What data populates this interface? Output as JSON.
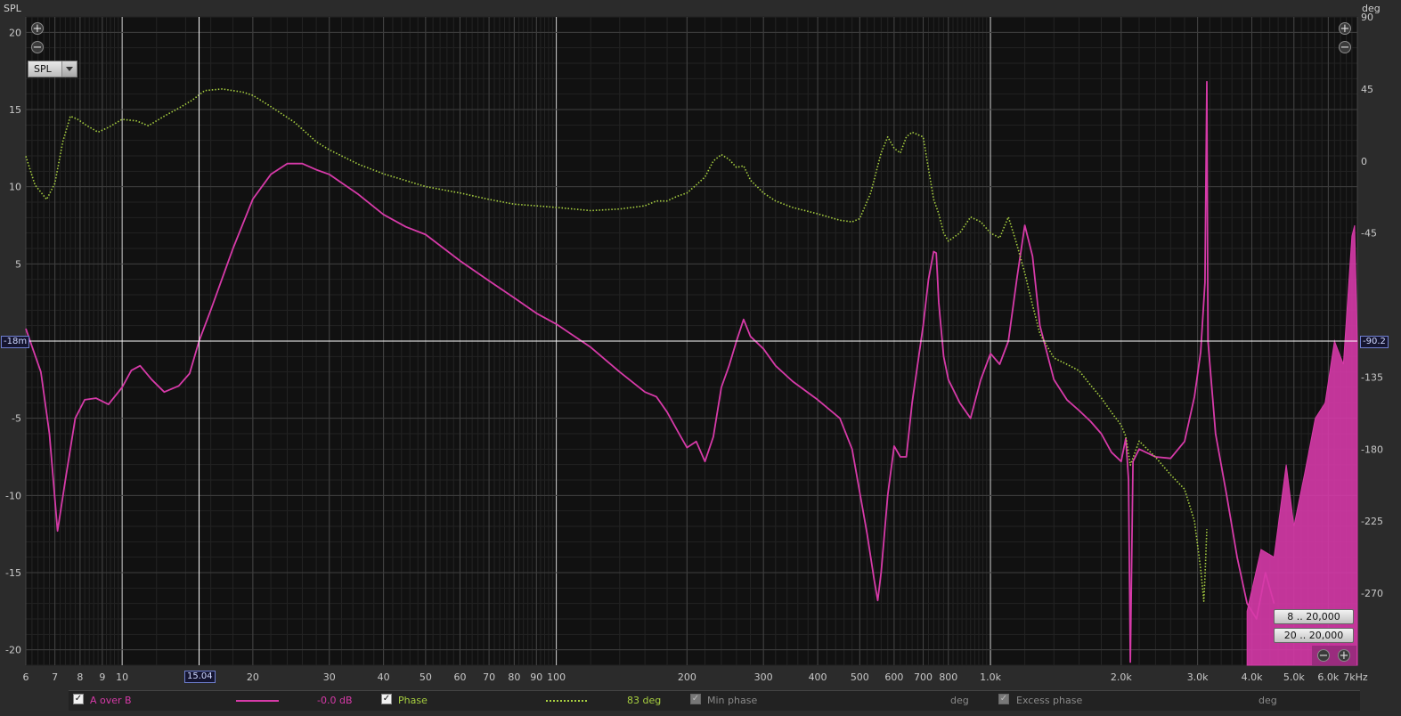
{
  "chart_data": {
    "type": "line",
    "x_scale": "log",
    "xlim": [
      6,
      7000
    ],
    "ylim_left": [
      -21,
      21
    ],
    "ylim_right": [
      -315,
      90
    ],
    "y_left_unit": "SPL",
    "y_right_unit": "deg",
    "x_unit": "kHz",
    "x_ticks": [
      {
        "v": 6,
        "label": "6"
      },
      {
        "v": 7,
        "label": "7"
      },
      {
        "v": 8,
        "label": "8"
      },
      {
        "v": 9,
        "label": "9"
      },
      {
        "v": 10,
        "label": "10"
      },
      {
        "v": 20,
        "label": "20"
      },
      {
        "v": 30,
        "label": "30"
      },
      {
        "v": 40,
        "label": "40"
      },
      {
        "v": 50,
        "label": "50"
      },
      {
        "v": 60,
        "label": "60"
      },
      {
        "v": 70,
        "label": "70"
      },
      {
        "v": 80,
        "label": "80"
      },
      {
        "v": 90,
        "label": "90"
      },
      {
        "v": 100,
        "label": "100"
      },
      {
        "v": 200,
        "label": "200"
      },
      {
        "v": 300,
        "label": "300"
      },
      {
        "v": 400,
        "label": "400"
      },
      {
        "v": 500,
        "label": "500"
      },
      {
        "v": 600,
        "label": "600"
      },
      {
        "v": 700,
        "label": "700"
      },
      {
        "v": 800,
        "label": "800"
      },
      {
        "v": 1000,
        "label": "1.0k"
      },
      {
        "v": 2000,
        "label": "2.0k"
      },
      {
        "v": 3000,
        "label": "3.0k"
      },
      {
        "v": 4000,
        "label": "4.0k"
      },
      {
        "v": 5000,
        "label": "5.0k"
      },
      {
        "v": 6000,
        "label": "6.0k"
      },
      {
        "v": 7000,
        "label": "7kHz"
      }
    ],
    "y_ticks_left": [
      20,
      15,
      10,
      5,
      -5,
      -10,
      -15,
      -20
    ],
    "y_ticks_right": [
      90,
      45,
      0,
      -45,
      -135,
      -180,
      -225,
      -270
    ],
    "cursor": {
      "x": 15.04,
      "x_label": "15.04",
      "y_left_label": "-18m",
      "y_right_label": "-90.2"
    },
    "series": [
      {
        "name": "A over B",
        "axis": "left",
        "color": "#d63aa8",
        "style": "solid",
        "points": [
          [
            6,
            0.8
          ],
          [
            6.5,
            -2
          ],
          [
            6.8,
            -6
          ],
          [
            7.1,
            -12.3
          ],
          [
            7.4,
            -9
          ],
          [
            7.8,
            -5
          ],
          [
            8.2,
            -3.8
          ],
          [
            8.7,
            -3.7
          ],
          [
            9.3,
            -4.1
          ],
          [
            10,
            -3
          ],
          [
            10.5,
            -1.9
          ],
          [
            11,
            -1.6
          ],
          [
            11.7,
            -2.5
          ],
          [
            12.5,
            -3.3
          ],
          [
            13.5,
            -2.9
          ],
          [
            14.3,
            -2.1
          ],
          [
            15.04,
            0
          ],
          [
            16,
            2
          ],
          [
            18,
            6
          ],
          [
            20,
            9.2
          ],
          [
            22,
            10.8
          ],
          [
            24,
            11.5
          ],
          [
            26,
            11.5
          ],
          [
            28,
            11.1
          ],
          [
            30,
            10.8
          ],
          [
            35,
            9.5
          ],
          [
            40,
            8.2
          ],
          [
            45,
            7.4
          ],
          [
            50,
            6.9
          ],
          [
            60,
            5.2
          ],
          [
            70,
            3.9
          ],
          [
            80,
            2.8
          ],
          [
            90,
            1.8
          ],
          [
            100,
            1.1
          ],
          [
            120,
            -0.4
          ],
          [
            140,
            -2
          ],
          [
            160,
            -3.3
          ],
          [
            170,
            -3.6
          ],
          [
            180,
            -4.6
          ],
          [
            190,
            -5.8
          ],
          [
            200,
            -6.9
          ],
          [
            210,
            -6.5
          ],
          [
            220,
            -7.8
          ],
          [
            230,
            -6.2
          ],
          [
            240,
            -3
          ],
          [
            250,
            -1.6
          ],
          [
            260,
            0
          ],
          [
            270,
            1.4
          ],
          [
            280,
            0.3
          ],
          [
            300,
            -0.5
          ],
          [
            320,
            -1.6
          ],
          [
            350,
            -2.6
          ],
          [
            400,
            -3.8
          ],
          [
            450,
            -5
          ],
          [
            480,
            -7
          ],
          [
            500,
            -9.8
          ],
          [
            520,
            -12.5
          ],
          [
            540,
            -15.5
          ],
          [
            550,
            -16.8
          ],
          [
            560,
            -15
          ],
          [
            580,
            -10
          ],
          [
            600,
            -6.8
          ],
          [
            620,
            -7.5
          ],
          [
            640,
            -7.5
          ],
          [
            660,
            -4
          ],
          [
            700,
            1
          ],
          [
            720,
            4
          ],
          [
            740,
            5.8
          ],
          [
            750,
            5.7
          ],
          [
            760,
            2.5
          ],
          [
            780,
            -1
          ],
          [
            800,
            -2.5
          ],
          [
            850,
            -4
          ],
          [
            900,
            -5
          ],
          [
            950,
            -2.5
          ],
          [
            1000,
            -0.8
          ],
          [
            1050,
            -1.5
          ],
          [
            1100,
            0
          ],
          [
            1150,
            4
          ],
          [
            1200,
            7.5
          ],
          [
            1250,
            5.5
          ],
          [
            1300,
            1
          ],
          [
            1400,
            -2.5
          ],
          [
            1500,
            -3.8
          ],
          [
            1600,
            -4.5
          ],
          [
            1700,
            -5.2
          ],
          [
            1800,
            -6
          ],
          [
            1900,
            -7.2
          ],
          [
            2000,
            -7.8
          ],
          [
            2050,
            -6.3
          ],
          [
            2080,
            -9
          ],
          [
            2100,
            -20.8
          ],
          [
            2130,
            -7.8
          ],
          [
            2200,
            -7
          ],
          [
            2400,
            -7.5
          ],
          [
            2600,
            -7.6
          ],
          [
            2800,
            -6.5
          ],
          [
            2950,
            -3.6
          ],
          [
            3050,
            -0.7
          ],
          [
            3120,
            3.8
          ],
          [
            3150,
            16.8
          ],
          [
            3170,
            0
          ],
          [
            3300,
            -6
          ],
          [
            3500,
            -10
          ],
          [
            3700,
            -14
          ],
          [
            3900,
            -17
          ],
          [
            4100,
            -18
          ],
          [
            4300,
            -15
          ],
          [
            4500,
            -17
          ]
        ],
        "fill_region": {
          "x_from": 3900,
          "x_to": 7000,
          "upper": [
            [
              3900,
              -17.5
            ],
            [
              4200,
              -13.5
            ],
            [
              4500,
              -14
            ],
            [
              4800,
              -8
            ],
            [
              5000,
              -12
            ],
            [
              5300,
              -8.5
            ],
            [
              5600,
              -5
            ],
            [
              5900,
              -4
            ],
            [
              6200,
              0
            ],
            [
              6500,
              -1.5
            ],
            [
              6800,
              6.8
            ],
            [
              6900,
              7.5
            ],
            [
              7000,
              0
            ]
          ]
        }
      },
      {
        "name": "Phase",
        "axis": "right",
        "color": "#a8d040",
        "style": "dotted",
        "points": [
          [
            6,
            3
          ],
          [
            6.3,
            -15
          ],
          [
            6.7,
            -24
          ],
          [
            7,
            -14
          ],
          [
            7.3,
            12
          ],
          [
            7.6,
            28
          ],
          [
            7.9,
            26
          ],
          [
            8.3,
            22
          ],
          [
            8.8,
            18
          ],
          [
            9.3,
            21
          ],
          [
            10,
            26
          ],
          [
            10.8,
            25
          ],
          [
            11.5,
            22
          ],
          [
            12.5,
            28
          ],
          [
            13.5,
            33
          ],
          [
            14.5,
            38
          ],
          [
            15.5,
            44
          ],
          [
            17,
            45
          ],
          [
            19,
            43
          ],
          [
            20,
            41
          ],
          [
            22,
            34
          ],
          [
            25,
            24
          ],
          [
            28,
            12
          ],
          [
            30,
            7
          ],
          [
            35,
            -2
          ],
          [
            40,
            -8
          ],
          [
            50,
            -16
          ],
          [
            60,
            -20
          ],
          [
            70,
            -24
          ],
          [
            80,
            -27
          ],
          [
            90,
            -28
          ],
          [
            100,
            -29
          ],
          [
            120,
            -31
          ],
          [
            140,
            -30
          ],
          [
            160,
            -28
          ],
          [
            170,
            -25
          ],
          [
            180,
            -25
          ],
          [
            190,
            -22
          ],
          [
            200,
            -20
          ],
          [
            210,
            -15
          ],
          [
            220,
            -10
          ],
          [
            230,
            0
          ],
          [
            240,
            4
          ],
          [
            250,
            1
          ],
          [
            260,
            -4
          ],
          [
            270,
            -3
          ],
          [
            280,
            -12
          ],
          [
            300,
            -20
          ],
          [
            320,
            -25
          ],
          [
            350,
            -29
          ],
          [
            400,
            -33
          ],
          [
            450,
            -37
          ],
          [
            480,
            -38
          ],
          [
            500,
            -36
          ],
          [
            530,
            -20
          ],
          [
            560,
            5
          ],
          [
            580,
            15
          ],
          [
            600,
            8
          ],
          [
            620,
            5
          ],
          [
            640,
            15
          ],
          [
            660,
            18
          ],
          [
            700,
            15
          ],
          [
            720,
            -5
          ],
          [
            740,
            -24
          ],
          [
            760,
            -33
          ],
          [
            780,
            -45
          ],
          [
            800,
            -50
          ],
          [
            850,
            -45
          ],
          [
            900,
            -35
          ],
          [
            950,
            -38
          ],
          [
            1000,
            -45
          ],
          [
            1050,
            -48
          ],
          [
            1100,
            -35
          ],
          [
            1150,
            -52
          ],
          [
            1200,
            -70
          ],
          [
            1250,
            -90
          ],
          [
            1300,
            -108
          ],
          [
            1400,
            -123
          ],
          [
            1500,
            -127
          ],
          [
            1600,
            -131
          ],
          [
            1700,
            -140
          ],
          [
            1800,
            -148
          ],
          [
            1900,
            -157
          ],
          [
            2000,
            -165
          ],
          [
            2050,
            -172
          ],
          [
            2100,
            -190
          ],
          [
            2200,
            -175
          ],
          [
            2400,
            -185
          ],
          [
            2600,
            -196
          ],
          [
            2800,
            -205
          ],
          [
            2950,
            -225
          ],
          [
            3050,
            -255
          ],
          [
            3100,
            -275
          ],
          [
            3120,
            -260
          ],
          [
            3150,
            -230
          ]
        ]
      }
    ]
  },
  "ui": {
    "y_left_unit": "SPL",
    "y_right_unit": "deg",
    "dropdown_value": "SPL",
    "range_btn_1": "8 .. 20,000",
    "range_btn_2": "20 .. 20,000",
    "legend": {
      "a_over_b_label": "A over B",
      "a_over_b_value": "-0.0 dB",
      "phase_label": "Phase",
      "phase_value": "83 deg",
      "min_phase_label": "Min phase",
      "min_phase_unit": "deg",
      "excess_phase_label": "Excess phase",
      "excess_phase_unit": "deg"
    },
    "colors": {
      "background": "#2b2b2b",
      "plot_bg": "#111111",
      "grid": "#3c3c3c",
      "a_over_b": "#d63aa8",
      "phase": "#a8d040",
      "min_phase_text": "#8a8a8a"
    }
  }
}
